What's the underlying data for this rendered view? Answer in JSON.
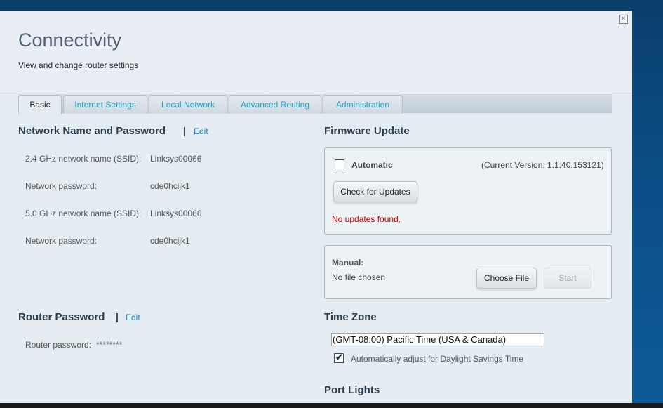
{
  "header": {
    "title": "Connectivity",
    "subtitle": "View and change router settings",
    "close_glyph": "×"
  },
  "tabs": [
    {
      "label": "Basic",
      "active": true
    },
    {
      "label": "Internet Settings",
      "active": false
    },
    {
      "label": "Local Network",
      "active": false
    },
    {
      "label": "Advanced Routing",
      "active": false
    },
    {
      "label": "Administration",
      "active": false
    }
  ],
  "network": {
    "title": "Network Name and Password",
    "separator": "|",
    "edit_label": "Edit",
    "fields": [
      {
        "label": "2.4 GHz network name (SSID):",
        "value": "Linksys00066"
      },
      {
        "label": "Network password:",
        "value": "cde0hcijk1"
      },
      {
        "label": "5.0 GHz network name (SSID):",
        "value": "Linksys00066"
      },
      {
        "label": "Network password:",
        "value": "cde0hcijk1"
      }
    ]
  },
  "router_password": {
    "title": "Router Password",
    "separator": "|",
    "edit_label": "Edit",
    "label": "Router password:",
    "value": "********"
  },
  "firmware": {
    "title": "Firmware Update",
    "automatic_label": "Automatic",
    "automatic_checked": false,
    "current_version": "(Current Version: 1.1.40.153121)",
    "check_button": "Check for Updates",
    "status": "No updates found.",
    "status_color": "#cc0000",
    "manual_label": "Manual:",
    "file_status": "No file chosen",
    "choose_button": "Choose File",
    "start_button": "Start"
  },
  "timezone": {
    "title": "Time Zone",
    "selected": "(GMT-08:00) Pacific Time (USA & Canada)",
    "dst_label": "Automatically adjust for Daylight Savings Time",
    "dst_checked": true,
    "check_glyph": "✔"
  },
  "port_lights": {
    "title": "Port Lights"
  },
  "colors": {
    "accent": "#1ea1c9",
    "link": "#1f7fb8",
    "error": "#cc0000"
  }
}
